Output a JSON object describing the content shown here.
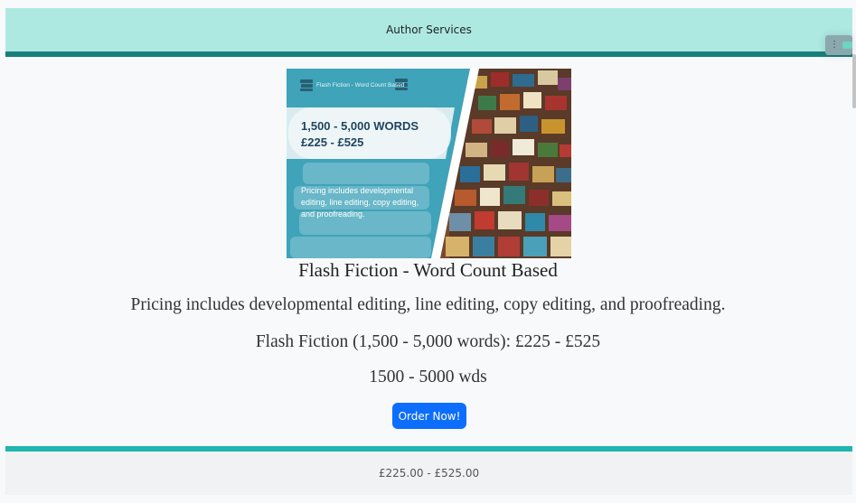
{
  "header": {
    "title": "Author Services"
  },
  "menu": {
    "icon": "kebab-menu-icon",
    "dots": "⋮"
  },
  "product": {
    "image": {
      "heading": "Flash Fiction - Word Count Based",
      "words": "1,500 - 5,000 WORDS",
      "price": "£225 - £525",
      "note_lines": [
        "Pricing includes developmental",
        "editing, line editing, copy editing,",
        "and proofreading."
      ]
    },
    "title": "Flash Fiction - Word Count Based",
    "description": "Pricing includes developmental editing, line editing, copy editing, and proofreading.",
    "price_line": "Flash Fiction (1,500 - 5,000 words): £225 - £525",
    "range": "1500 - 5000 wds",
    "order_label": "Order Now!"
  },
  "footer": {
    "price": "£225.00 - £525.00"
  },
  "colors": {
    "header_bg": "#ade9e1",
    "header_bar": "#177f7a",
    "footer_bar": "#1fb5b0",
    "button": "#0d6efd"
  }
}
